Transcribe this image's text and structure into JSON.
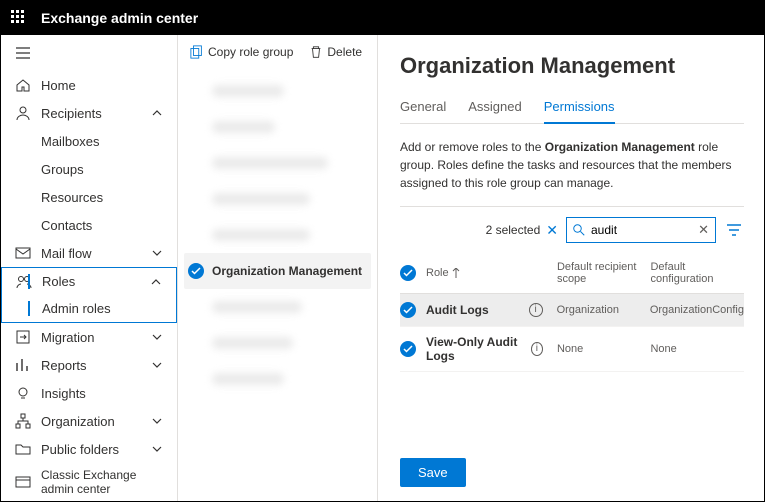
{
  "topbar": {
    "title": "Exchange admin center"
  },
  "nav": {
    "home": "Home",
    "recipients": {
      "label": "Recipients",
      "mailboxes": "Mailboxes",
      "groups": "Groups",
      "resources": "Resources",
      "contacts": "Contacts"
    },
    "mailflow": "Mail flow",
    "roles": {
      "label": "Roles",
      "admin_roles": "Admin roles"
    },
    "migration": "Migration",
    "reports": "Reports",
    "insights": "Insights",
    "organization": "Organization",
    "public_folders": "Public folders",
    "classic": "Classic Exchange admin center"
  },
  "middle": {
    "copy": "Copy role group",
    "delete": "Delete",
    "selected_label": "Organization Management"
  },
  "detail": {
    "title": "Organization Management",
    "tabs": {
      "general": "General",
      "assigned": "Assigned",
      "permissions": "Permissions"
    },
    "desc_prefix": "Add or remove roles to the ",
    "desc_bold": "Organization Management",
    "desc_suffix": " role group. Roles define the tasks and resources that the members assigned to this role group can manage.",
    "selected_count": "2 selected",
    "search_value": "audit",
    "columns": {
      "role": "Role",
      "scope": "Default recipient scope",
      "config": "Default configuration"
    },
    "rows": [
      {
        "role": "Audit Logs",
        "scope": "Organization",
        "config": "OrganizationConfig"
      },
      {
        "role": "View-Only Audit Logs",
        "scope": "None",
        "config": "None"
      }
    ],
    "save": "Save"
  }
}
